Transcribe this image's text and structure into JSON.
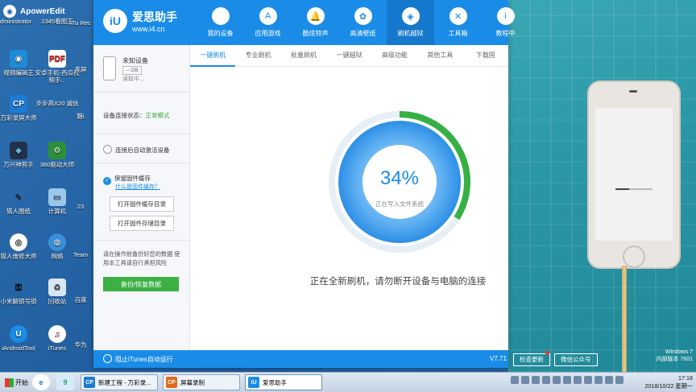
{
  "desktop": {
    "apowersoft": "ApowerEdit",
    "icons": [
      {
        "label": "Administrator"
      },
      {
        "label": "2345看图王"
      },
      {
        "label": "视频编辑王"
      },
      {
        "label": "安卓手机-西瓜视频手..."
      },
      {
        "label": "万彩录屏大师"
      },
      {
        "label": "步步高X20 诚信"
      },
      {
        "label": "万兴神剪手"
      },
      {
        "label": "360驱动大师"
      },
      {
        "label": "猎人图纸"
      },
      {
        "label": "计算机"
      },
      {
        "label": "猎人维修大师"
      },
      {
        "label": "网络"
      },
      {
        "label": "小米解锁号锁"
      },
      {
        "label": "回收站"
      },
      {
        "label": "iAndroidTool"
      },
      {
        "label": "iTunes"
      }
    ],
    "partial": [
      "iTu Rec",
      "亮屏",
      "魅i",
      "23",
      "Team",
      "百度",
      "华为"
    ]
  },
  "app": {
    "logo_title": "爱思助手",
    "logo_url": "www.i4.cn",
    "nav": [
      {
        "label": "我的设备",
        "icon": ""
      },
      {
        "label": "应用游戏",
        "icon": "A"
      },
      {
        "label": "酷炫铃声",
        "icon": "🔔"
      },
      {
        "label": "高清壁纸",
        "icon": "✿"
      },
      {
        "label": "刷机越狱",
        "icon": "◈"
      },
      {
        "label": "工具箱",
        "icon": "✕"
      },
      {
        "label": "教程中",
        "icon": "i"
      }
    ],
    "device": {
      "name": "未知设备",
      "capacity": "-- GB",
      "state": "读取中..."
    },
    "connection_label": "设备连接状态：",
    "connection_value": "正常模式",
    "auto_activate": "连接后自动激活设备",
    "keep_firmware": "保留固件缓存",
    "what_is_firmware": "什么是固件缓存？",
    "open_cache": "打开固件缓存目录",
    "open_storage": "打开固件存储目录",
    "note": "请在操作前备份好您的数据 使用本工具请自行承担风险",
    "backup_button": "备份/恢复数据",
    "tabs": [
      "一键刷机",
      "专业刷机",
      "批量刷机",
      "一键越狱",
      "高级功能",
      "其他工具",
      "下载固"
    ],
    "progress_label": "34%",
    "progress_value": 0.34,
    "progress_status": "正在写入文件系统",
    "message": "正在全新刷机，请勿断开设备与电脑的连接",
    "itunes_block": "阻止iTunes自动运行",
    "version": "V7.71",
    "check_update": "检查更新",
    "wechat": "微信公众号"
  },
  "taskbar": {
    "start": "开始",
    "tasks": [
      "新建工程 - 万彩录...",
      "屏幕录制",
      "爱思助手"
    ],
    "time": "17:18",
    "date": "2018/10/22 星期一"
  },
  "photo": {
    "windows": "Windows 7",
    "build": "内部版本 7601"
  }
}
